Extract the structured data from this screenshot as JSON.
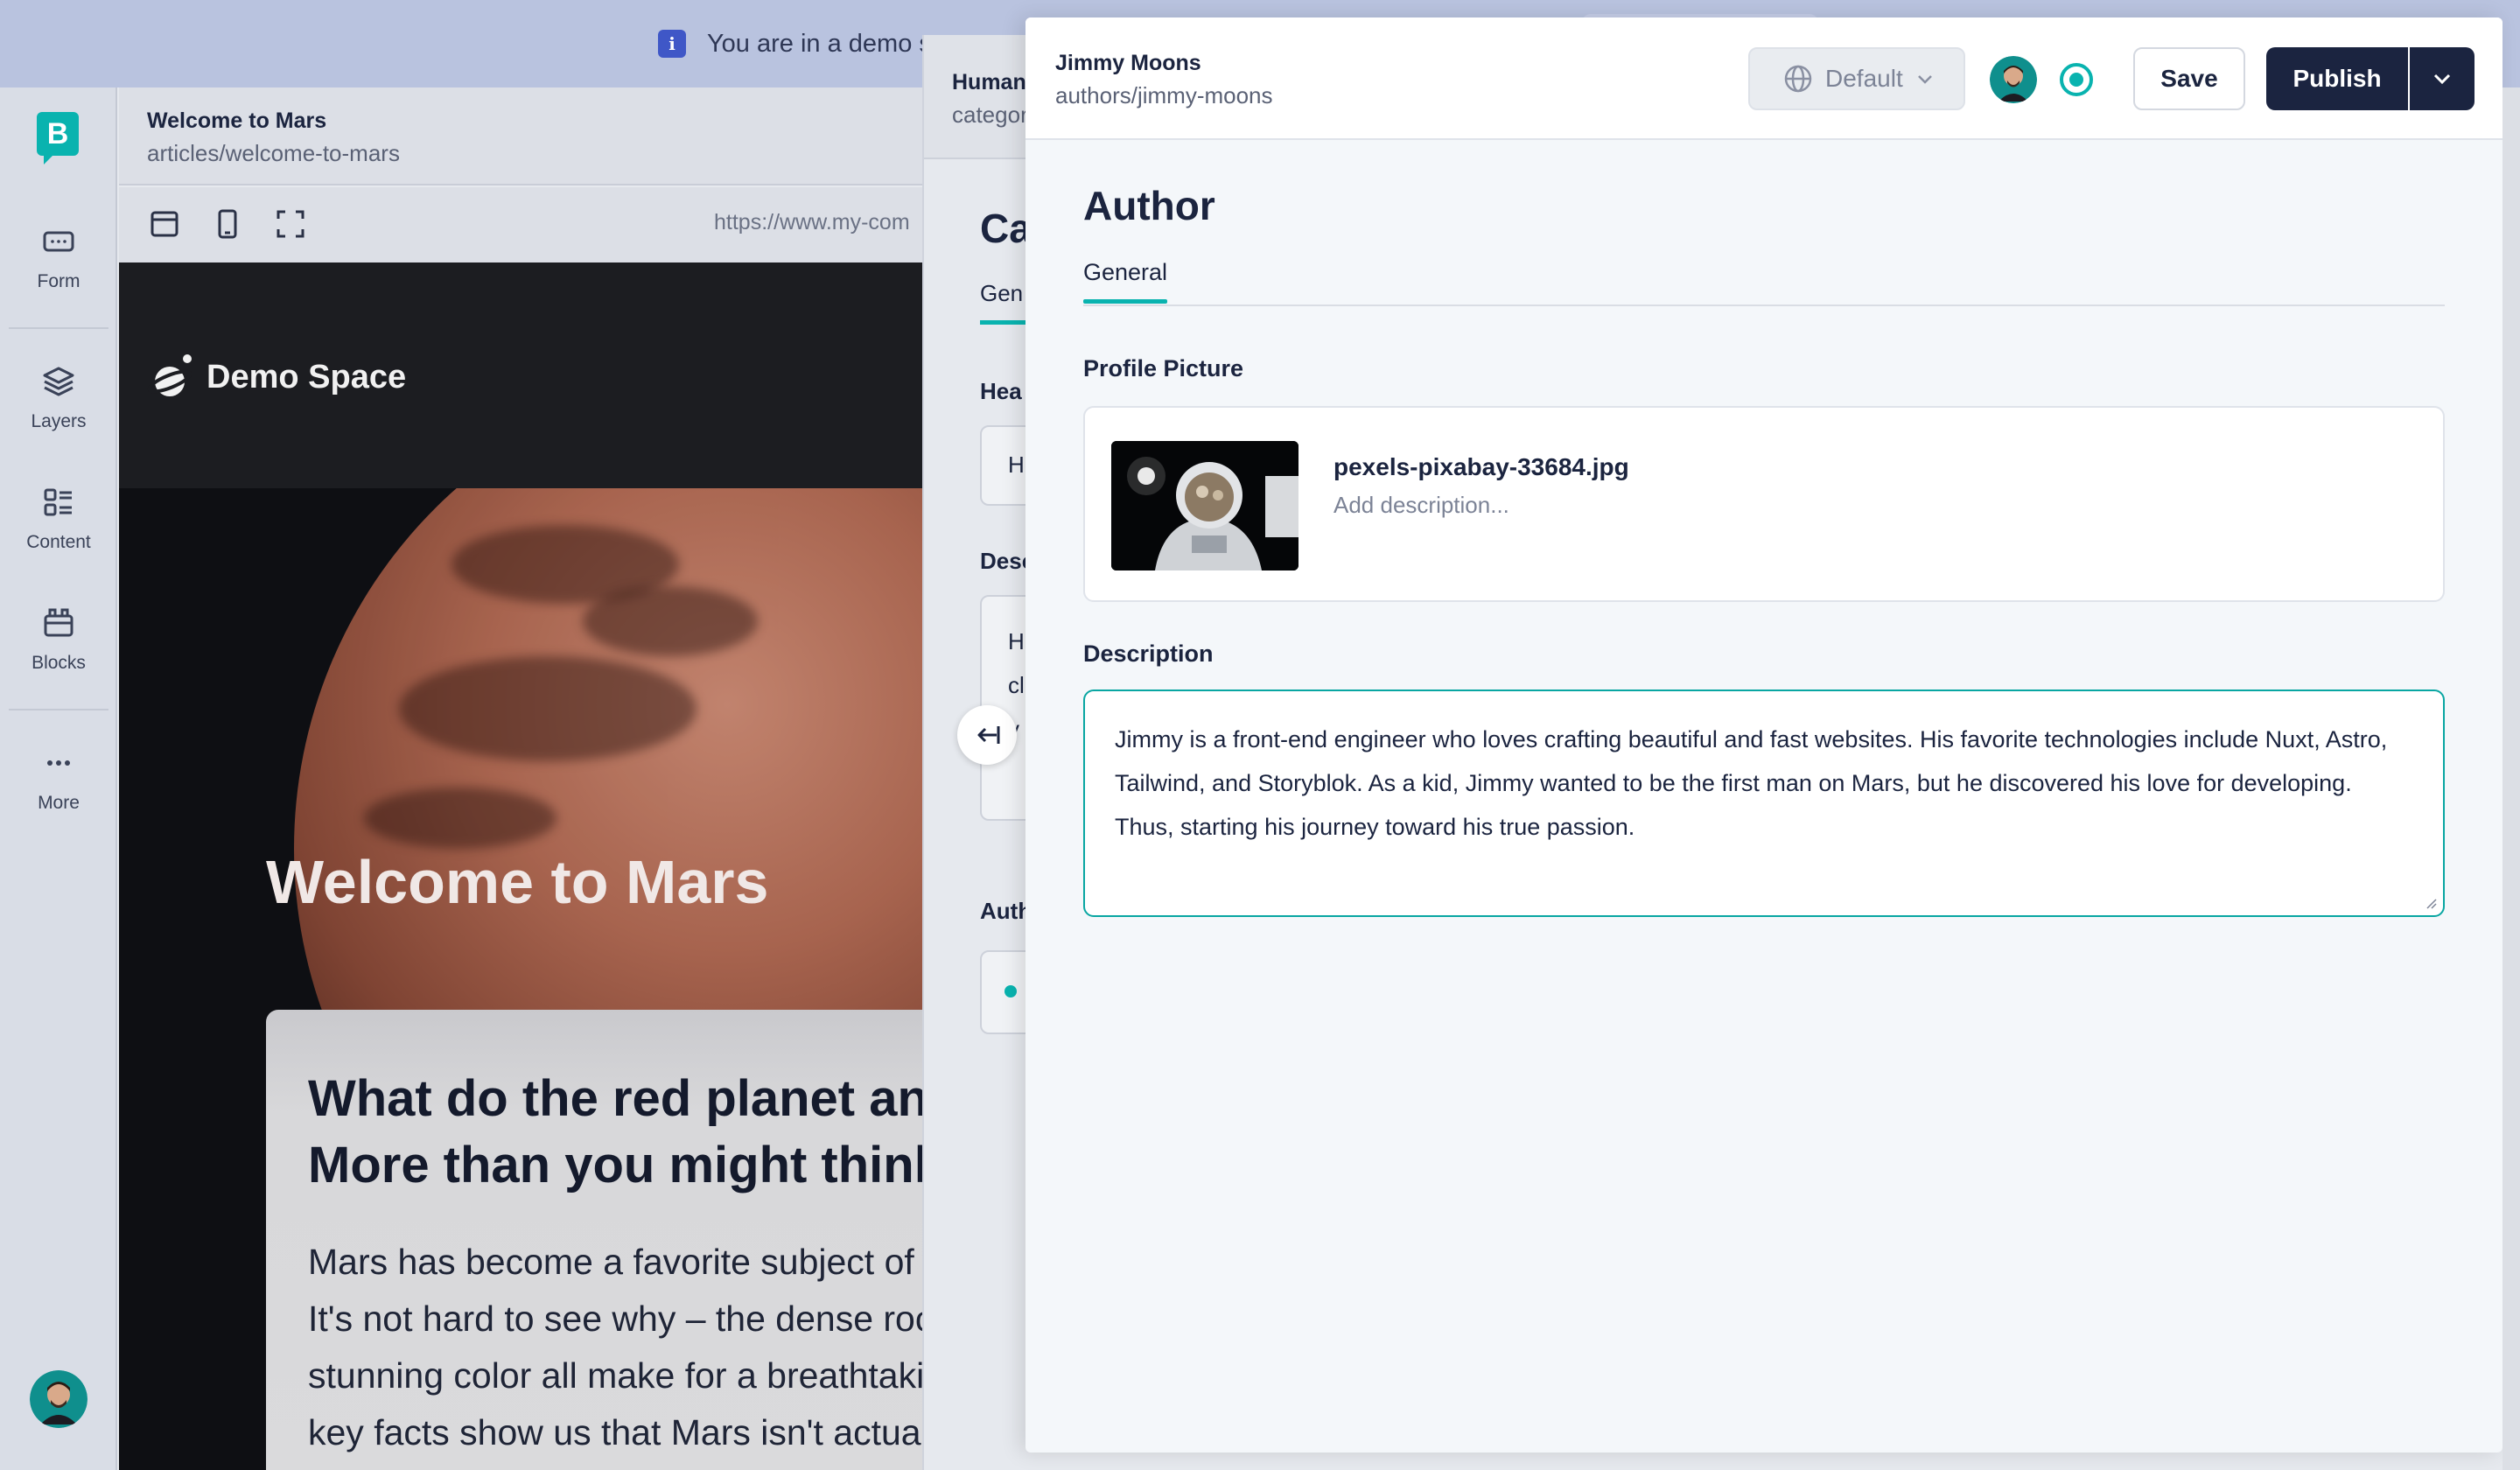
{
  "banner": {
    "text": "You are in a demo s"
  },
  "rail": {
    "logo_letter": "B",
    "items": [
      {
        "label": "Form",
        "icon": "form-icon"
      },
      {
        "label": "Layers",
        "icon": "layers-icon"
      },
      {
        "label": "Content",
        "icon": "content-icon"
      },
      {
        "label": "Blocks",
        "icon": "blocks-icon"
      },
      {
        "label": "More",
        "icon": "more-icon"
      }
    ]
  },
  "story": {
    "title": "Welcome to Mars",
    "slug": "articles/welcome-to-mars",
    "preview_url": "https://www.my-com"
  },
  "preview": {
    "brand": "Demo Space",
    "hero_title": "Welcome to Mars",
    "card_heading_line1": "What do the red planet and",
    "card_heading_line2": "More than you might think",
    "card_lines": [
      "Mars has become a favorite subject of e",
      "It's not hard to see why – the dense rocl",
      "stunning color all make for a breathtaki",
      "key facts show us that Mars isn't actually that"
    ]
  },
  "parent_story": {
    "title": "Human",
    "slug": "categor",
    "heading": "Ca",
    "tab": "Gen",
    "label_headline": "Hea",
    "headline_value": "H",
    "label_description": "Desc",
    "description_lines": [
      "H",
      "cl",
      "v"
    ],
    "label_author": "Auth"
  },
  "author": {
    "name": "Jimmy Moons",
    "slug": "authors/jimmy-moons",
    "language": "Default",
    "save_label": "Save",
    "publish_label": "Publish",
    "component_title": "Author",
    "tab_general": "General",
    "profile_picture_label": "Profile Picture",
    "asset_filename": "pexels-pixabay-33684.jpg",
    "asset_description_placeholder": "Add description...",
    "description_label": "Description",
    "description_value": "Jimmy is a front-end engineer who loves crafting beautiful and fast websites. His favorite technologies include Nuxt, Astro, Tailwind, and Storyblok. As a kid, Jimmy wanted to be the first man on Mars, but he discovered his love for developing. Thus, starting his journey toward his true passion."
  },
  "colors": {
    "accent": "#09b3af",
    "primary_button": "#1b2440",
    "banner": "#b9c3df"
  }
}
